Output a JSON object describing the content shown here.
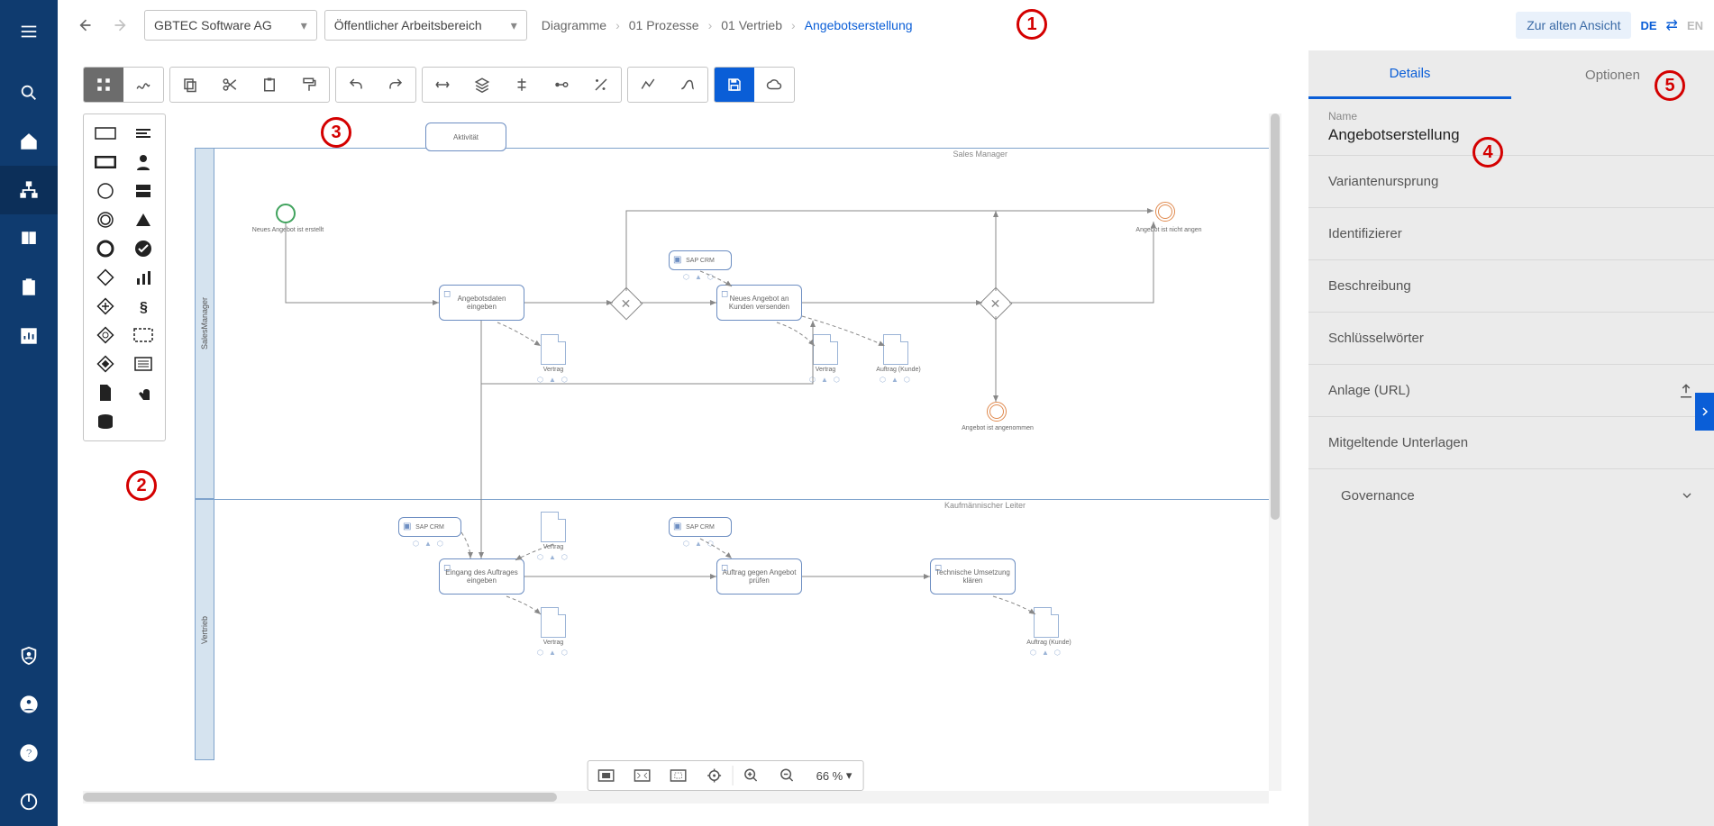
{
  "top": {
    "tenant": "GBTEC Software AG",
    "workspace": "Öffentlicher Arbeitsbereich",
    "breadcrumb": [
      "Diagramme",
      "01 Prozesse",
      "01 Vertrieb",
      "Angebotserstellung"
    ],
    "old_view": "Zur alten Ansicht",
    "lang": {
      "de": "DE",
      "en": "EN"
    }
  },
  "zoom": {
    "value": "66 %"
  },
  "details": {
    "tab_details": "Details",
    "tab_options": "Optionen",
    "name_label": "Name",
    "name_value": "Angebotserstellung",
    "rows": {
      "variant": "Variantenursprung",
      "identifier": "Identifizierer",
      "description": "Beschreibung",
      "keywords": "Schlüsselwörter",
      "attachment": "Anlage (URL)",
      "related": "Mitgeltende Unterlagen",
      "governance": "Governance"
    }
  },
  "diagram": {
    "template_shape": "Aktivität",
    "pool": "Vertrieb",
    "lane1": "Sales Manager",
    "lane1_vert": "SalesManager",
    "lane2": "Kaufmännischer Leiter",
    "events": {
      "start": "Neues Angebot ist erstellt",
      "end_rejected": "Angebot ist nicht angen",
      "inter_accepted": "Angebot ist angenommen"
    },
    "tasks": {
      "a1": "Angebotsdaten eingeben",
      "a2": "Neues Angebot an Kunden versenden",
      "b1": "Eingang des Auftrages eingeben",
      "b2": "Auftrag gegen Angebot prüfen",
      "b3": "Technische Umsetzung klären"
    },
    "sap": "SAP CRM",
    "docs": {
      "vertrag": "Vertrag",
      "auftrag": "Auftrag (Kunde)"
    }
  },
  "annotations": {
    "1": "1",
    "2": "2",
    "3": "3",
    "4": "4",
    "5": "5"
  }
}
